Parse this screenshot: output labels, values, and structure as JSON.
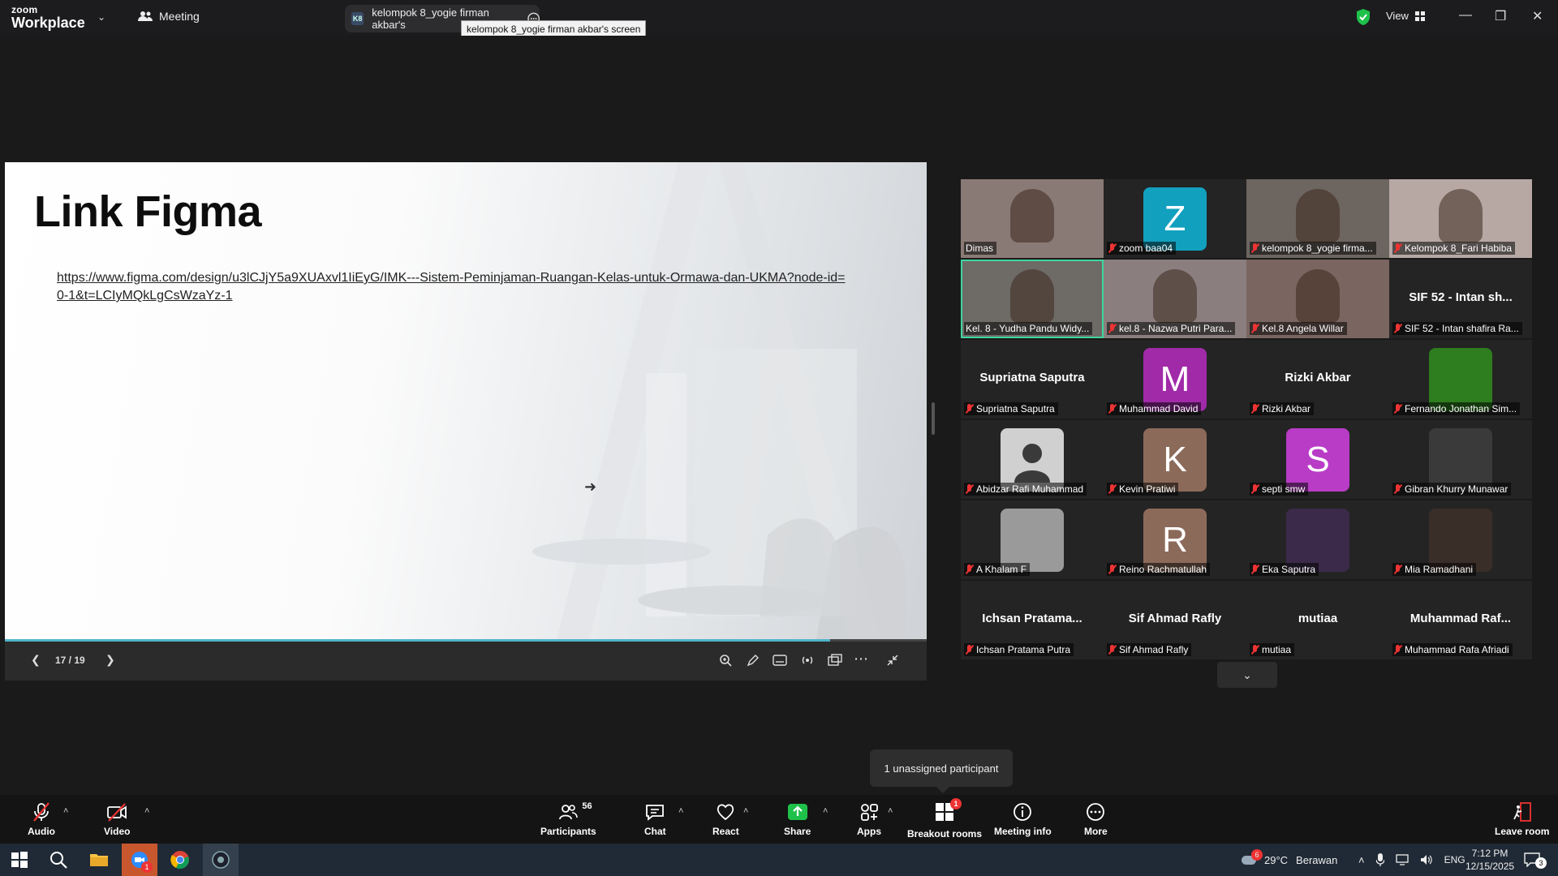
{
  "titlebar": {
    "brand_top": "zoom",
    "brand_bottom": "Workplace",
    "meeting_tab": "Meeting",
    "share_tab_badge": "K8",
    "share_tab": "kelompok 8_yogie firman akbar's",
    "tooltip": "kelompok 8_yogie firman akbar's screen",
    "view_label": "View"
  },
  "slide": {
    "title": "Link Figma",
    "link": " https://www.figma.com/design/u3lCJjY5a9XUAxvl1IiEyG/IMK---Sistem-Peminjaman-Ruangan-Kelas-untuk-Ormawa-dan-UKMA?node-id=0-1&t=LCIyMQkLgCsWzaYz-1",
    "page_indicator": "17 / 19",
    "progress": 0.895
  },
  "gallery": [
    {
      "name": "Dimas",
      "kind": "video",
      "muted": false,
      "color": "#8a7a75"
    },
    {
      "name": "zoom baa04",
      "kind": "avatar",
      "letter": "Z",
      "color": "#12a0bf",
      "muted": true
    },
    {
      "name": "kelompok 8_yogie firma...",
      "kind": "video",
      "muted": true,
      "color": "#6d6560"
    },
    {
      "name": "Kelompok 8_Fari Habiba",
      "kind": "video",
      "muted": true,
      "color": "#b7a8a4"
    },
    {
      "name": "Kel. 8 - Yudha Pandu Widy...",
      "kind": "video",
      "muted": false,
      "color": "#6e6a66",
      "active": true
    },
    {
      "name": "kel.8 - Nazwa Putri Para...",
      "kind": "video",
      "muted": true,
      "color": "#8b7e7e"
    },
    {
      "name": "Kel.8 Angela Willar",
      "kind": "video",
      "muted": true,
      "color": "#7a6560"
    },
    {
      "name": "SIF 52 - Intan shafira Ra...",
      "kind": "name",
      "big": "SIF 52 - Intan sh...",
      "muted": true
    },
    {
      "name": "Supriatna Saputra",
      "kind": "name",
      "big": "Supriatna Saputra",
      "muted": true
    },
    {
      "name": "Muhammad David",
      "kind": "avatar",
      "letter": "M",
      "color": "#a12aa8",
      "muted": true
    },
    {
      "name": "Rizki Akbar",
      "kind": "name",
      "big": "Rizki Akbar",
      "muted": true
    },
    {
      "name": "Fernando Jonathan Sim...",
      "kind": "avatar",
      "letter": "",
      "color": "#2e7d1e",
      "muted": true
    },
    {
      "name": "Abidzar Rafi Muhammad",
      "kind": "avatar",
      "letter": "",
      "color": "#d0d0d0",
      "person": true,
      "muted": true
    },
    {
      "name": "Kevin Pratiwi",
      "kind": "avatar",
      "letter": "K",
      "color": "#8c6a5a",
      "muted": true
    },
    {
      "name": "septi smw",
      "kind": "avatar",
      "letter": "S",
      "color": "#b83cc6",
      "muted": true
    },
    {
      "name": "Gibran Khurry Munawar",
      "kind": "avatar",
      "letter": "",
      "color": "#3a3a3a",
      "muted": true
    },
    {
      "name": "A Khalam F",
      "kind": "avatar",
      "letter": "",
      "color": "#9a9a9a",
      "muted": true
    },
    {
      "name": "Reino Rachmatullah",
      "kind": "avatar",
      "letter": "R",
      "color": "#8c6a5a",
      "muted": true
    },
    {
      "name": "Eka Saputra",
      "kind": "avatar",
      "letter": "",
      "color": "#3b2a4a",
      "muted": true
    },
    {
      "name": "Mia Ramadhani",
      "kind": "avatar",
      "letter": "",
      "color": "#3a2e28",
      "muted": true
    },
    {
      "name": "Ichsan Pratama Putra",
      "kind": "name",
      "big": "Ichsan  Pratama...",
      "muted": true
    },
    {
      "name": "Sif Ahmad Rafly",
      "kind": "name",
      "big": "Sif Ahmad Rafly",
      "muted": true
    },
    {
      "name": "mutiaa",
      "kind": "name",
      "big": "mutiaa",
      "muted": true
    },
    {
      "name": "Muhammad Rafa Afriadi",
      "kind": "name",
      "big": "Muhammad  Raf...",
      "muted": true
    }
  ],
  "popover": {
    "unassigned": "1 unassigned participant"
  },
  "toolbar": {
    "audio": "Audio",
    "video": "Video",
    "participants": "Participants",
    "participants_count": "56",
    "chat": "Chat",
    "react": "React",
    "share": "Share",
    "apps": "Apps",
    "breakout": "Breakout rooms",
    "breakout_badge": "1",
    "meeting_info": "Meeting info",
    "more": "More",
    "leave": "Leave room"
  },
  "taskbar": {
    "weather_temp": "29°C",
    "weather_text": "Berawan",
    "lang": "ENG",
    "time": "7:12 PM",
    "date": "12/15/2025",
    "notif_count": "3",
    "zoom_badge": "1",
    "weather_badge": "6"
  },
  "colors": {
    "accent": "#3ed6a0",
    "progress": "#4fb4c8",
    "mute": "#e33333",
    "share_green": "#1ec24a"
  }
}
